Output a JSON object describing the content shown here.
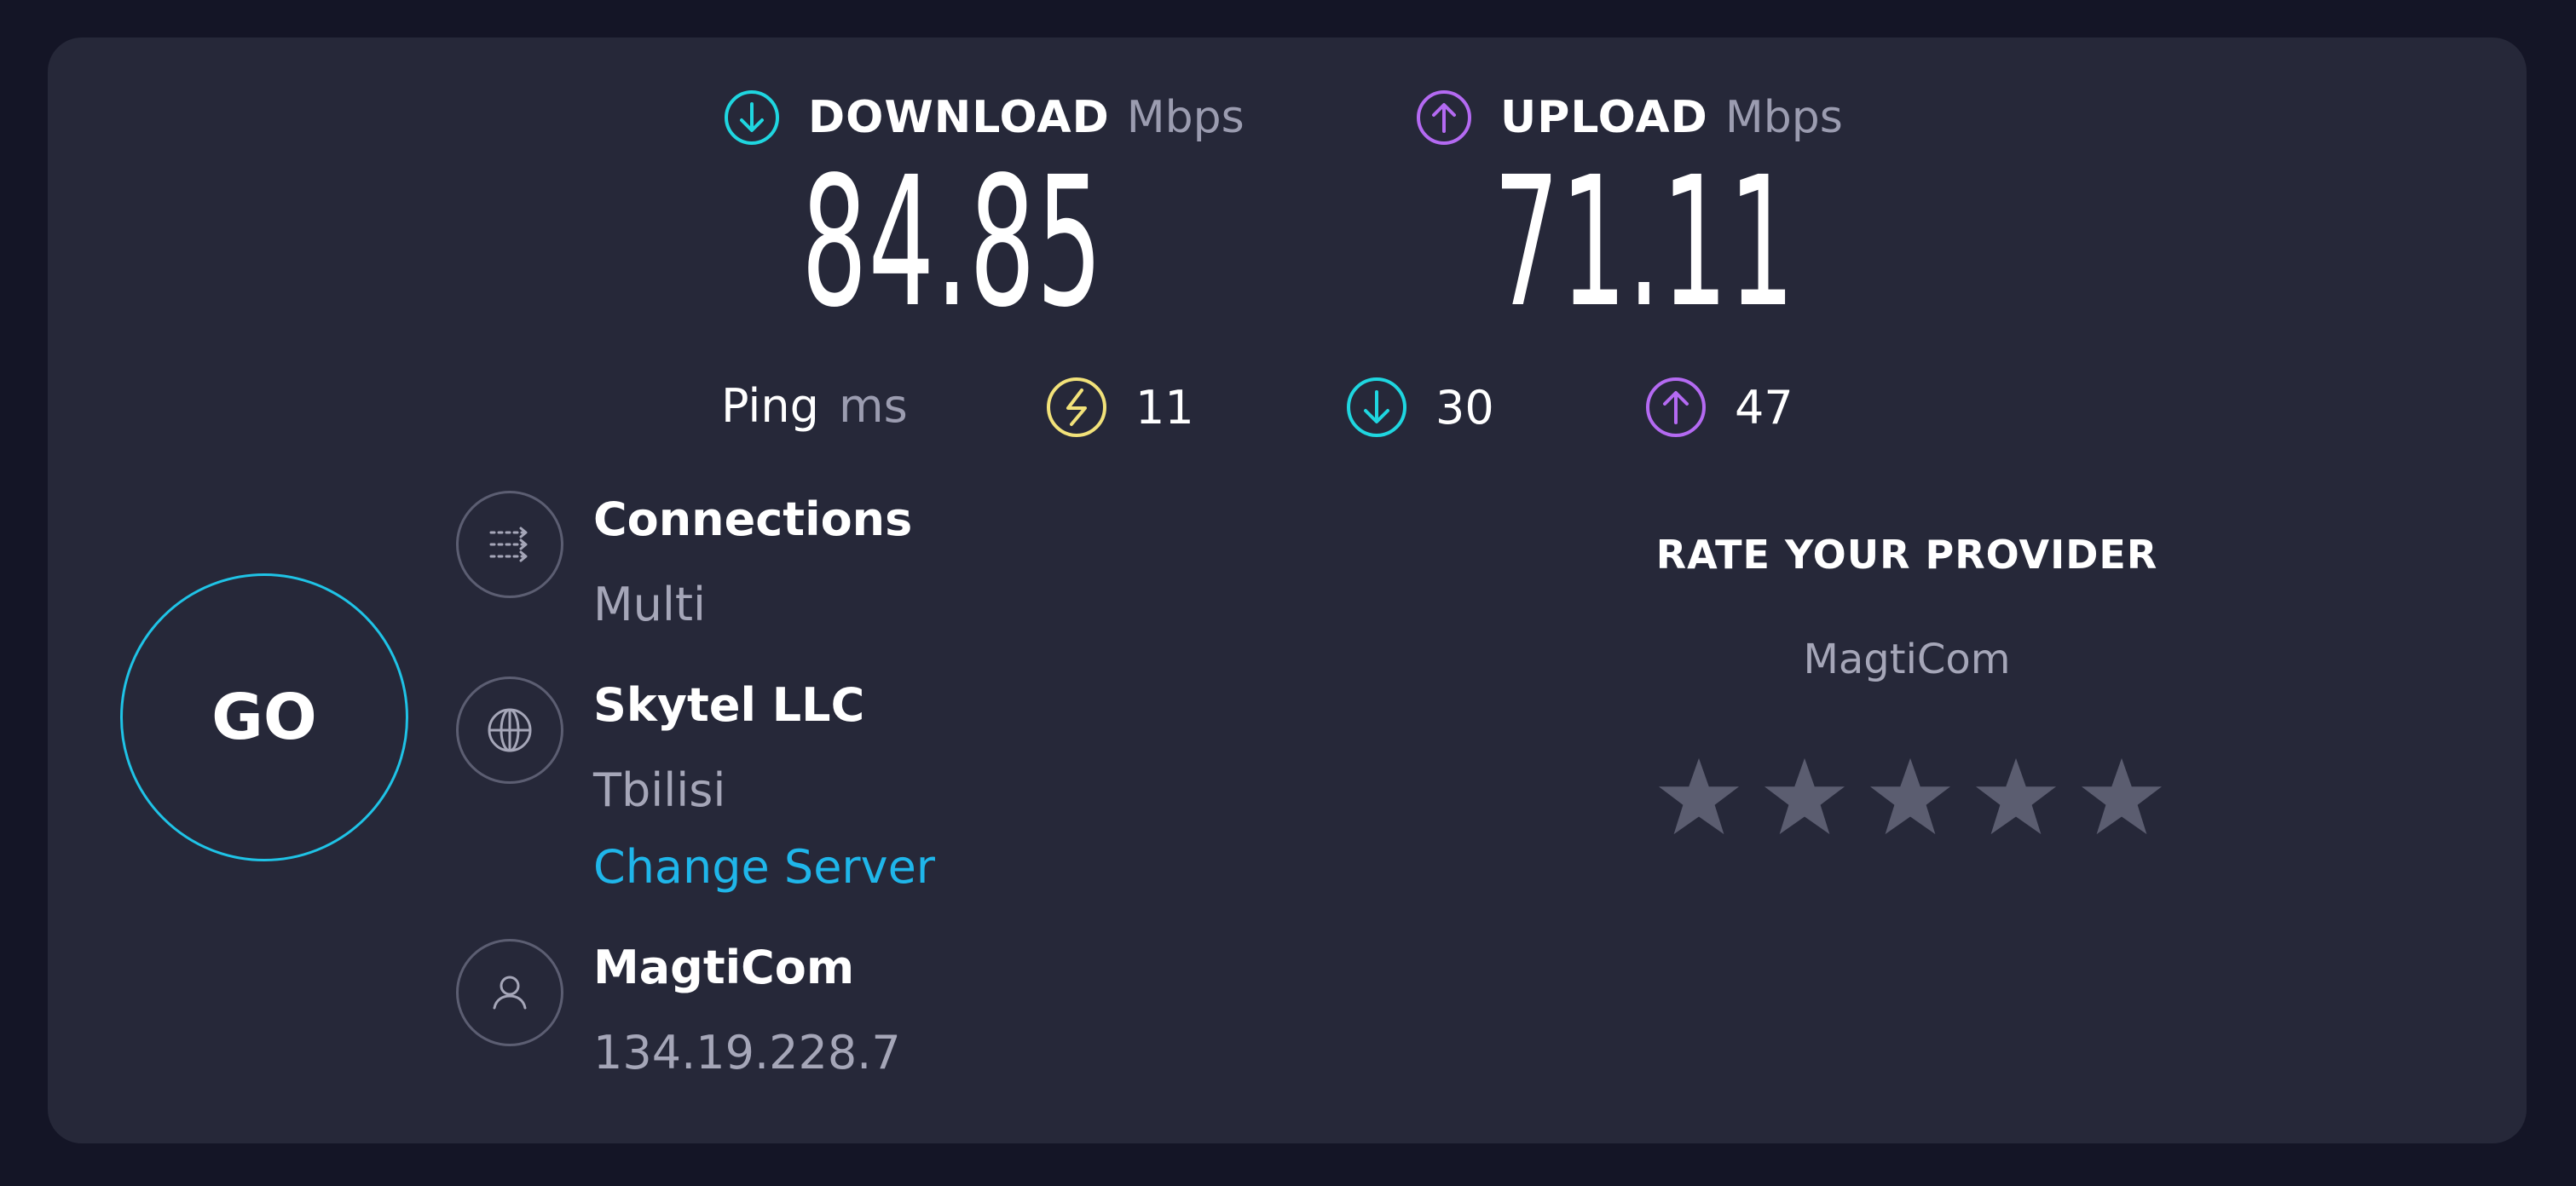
{
  "download": {
    "label": "DOWNLOAD",
    "unit": "Mbps",
    "value": "84.85",
    "icon": "download-icon",
    "color": "#1fd6e0"
  },
  "upload": {
    "label": "UPLOAD",
    "unit": "Mbps",
    "value": "71.11",
    "icon": "upload-icon",
    "color": "#b46af2"
  },
  "ping": {
    "label": "Ping",
    "unit": "ms",
    "idle": {
      "value": "11",
      "icon": "idle-latency-icon",
      "color": "#f2e27a"
    },
    "down": {
      "value": "30",
      "icon": "download-icon",
      "color": "#1fd6e0"
    },
    "up": {
      "value": "47",
      "icon": "upload-icon",
      "color": "#b46af2"
    }
  },
  "go_button": {
    "label": "GO",
    "color": "#1fc3e6"
  },
  "connections": {
    "title": "Connections",
    "value": "Multi",
    "icon": "connections-icon"
  },
  "server": {
    "title": "Skytel LLC",
    "location": "Tbilisi",
    "change_label": "Change Server",
    "icon": "globe-icon"
  },
  "provider": {
    "title": "MagtiCom",
    "ip": "134.19.228.7",
    "icon": "user-icon"
  },
  "rate": {
    "title": "RATE YOUR PROVIDER",
    "provider_name": "MagtiCom",
    "rating": 0,
    "max_rating": 5,
    "star_color": "#5b5d70"
  }
}
